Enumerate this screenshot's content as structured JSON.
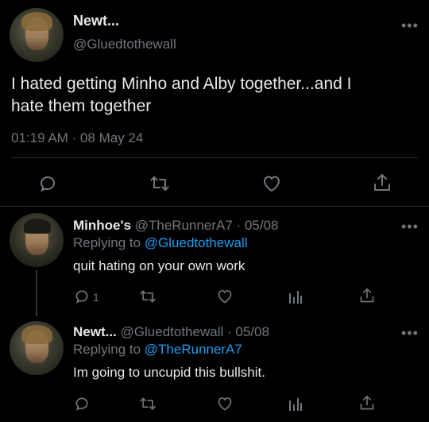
{
  "main_tweet": {
    "display_name": "Newt...",
    "handle": "@Gluedtothewall",
    "text_line1": "I hated getting Minho and Alby together...and I",
    "text_line2": "hate them together",
    "timestamp": "01:19 AM · 08 May 24"
  },
  "reply1": {
    "display_name": "Minhoe's",
    "handle_date": "@TheRunnerA7 · 05/08",
    "replying_prefix": "Replying to ",
    "replying_handle": "@Gluedtothewall",
    "text": "quit hating on your own work",
    "reply_count": "1"
  },
  "reply2": {
    "display_name": "Newt...",
    "handle_date": "@Gluedtothewall · 05/08",
    "replying_prefix": "Replying to ",
    "replying_handle": "@TheRunnerA7",
    "text": "Im going to uncupid this bullshit."
  },
  "more_glyph": "•••",
  "colors": {
    "background": "#000000",
    "text": "#e7e9ea",
    "secondary": "#71767b",
    "link": "#1d9bf0",
    "divider": "#2f3336"
  },
  "icons": [
    "reply-icon",
    "retweet-icon",
    "like-icon",
    "share-icon",
    "analytics-icon",
    "more-icon"
  ]
}
